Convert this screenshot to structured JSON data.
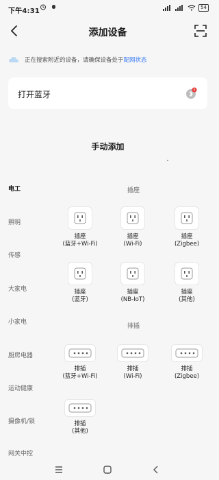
{
  "status": {
    "time": "下午4:31",
    "battery": "54"
  },
  "header": {
    "title": "添加设备"
  },
  "hint": {
    "text": "正在搜索附近的设备，请确保设备处于",
    "link": "配网状态"
  },
  "bluetooth": {
    "label": "打开蓝牙"
  },
  "manual": {
    "title": "手动添加"
  },
  "categories": [
    "电工",
    "照明",
    "传感",
    "大家电",
    "小家电",
    "厨房电器",
    "运动健康",
    "摄像机/锁",
    "网关中控"
  ],
  "sections": {
    "socket": "插座",
    "strip": "排插"
  },
  "sockets": [
    {
      "line1": "插座",
      "line2": "(蓝牙+Wi-Fi)"
    },
    {
      "line1": "插座",
      "line2": "(Wi-Fi)"
    },
    {
      "line1": "插座",
      "line2": "(Zigbee)"
    },
    {
      "line1": "插座",
      "line2": "(蓝牙)"
    },
    {
      "line1": "插座",
      "line2": "(NB-IoT)"
    },
    {
      "line1": "插座",
      "line2": "(其他)"
    }
  ],
  "strips": [
    {
      "line1": "排插",
      "line2": "(蓝牙+Wi-Fi)"
    },
    {
      "line1": "排插",
      "line2": "(Wi-Fi)"
    },
    {
      "line1": "排插",
      "line2": "(Zigbee)"
    },
    {
      "line1": "排插",
      "line2": "(其他)"
    }
  ],
  "colors": {
    "link": "#3b7cf5",
    "badge": "#e53935"
  }
}
